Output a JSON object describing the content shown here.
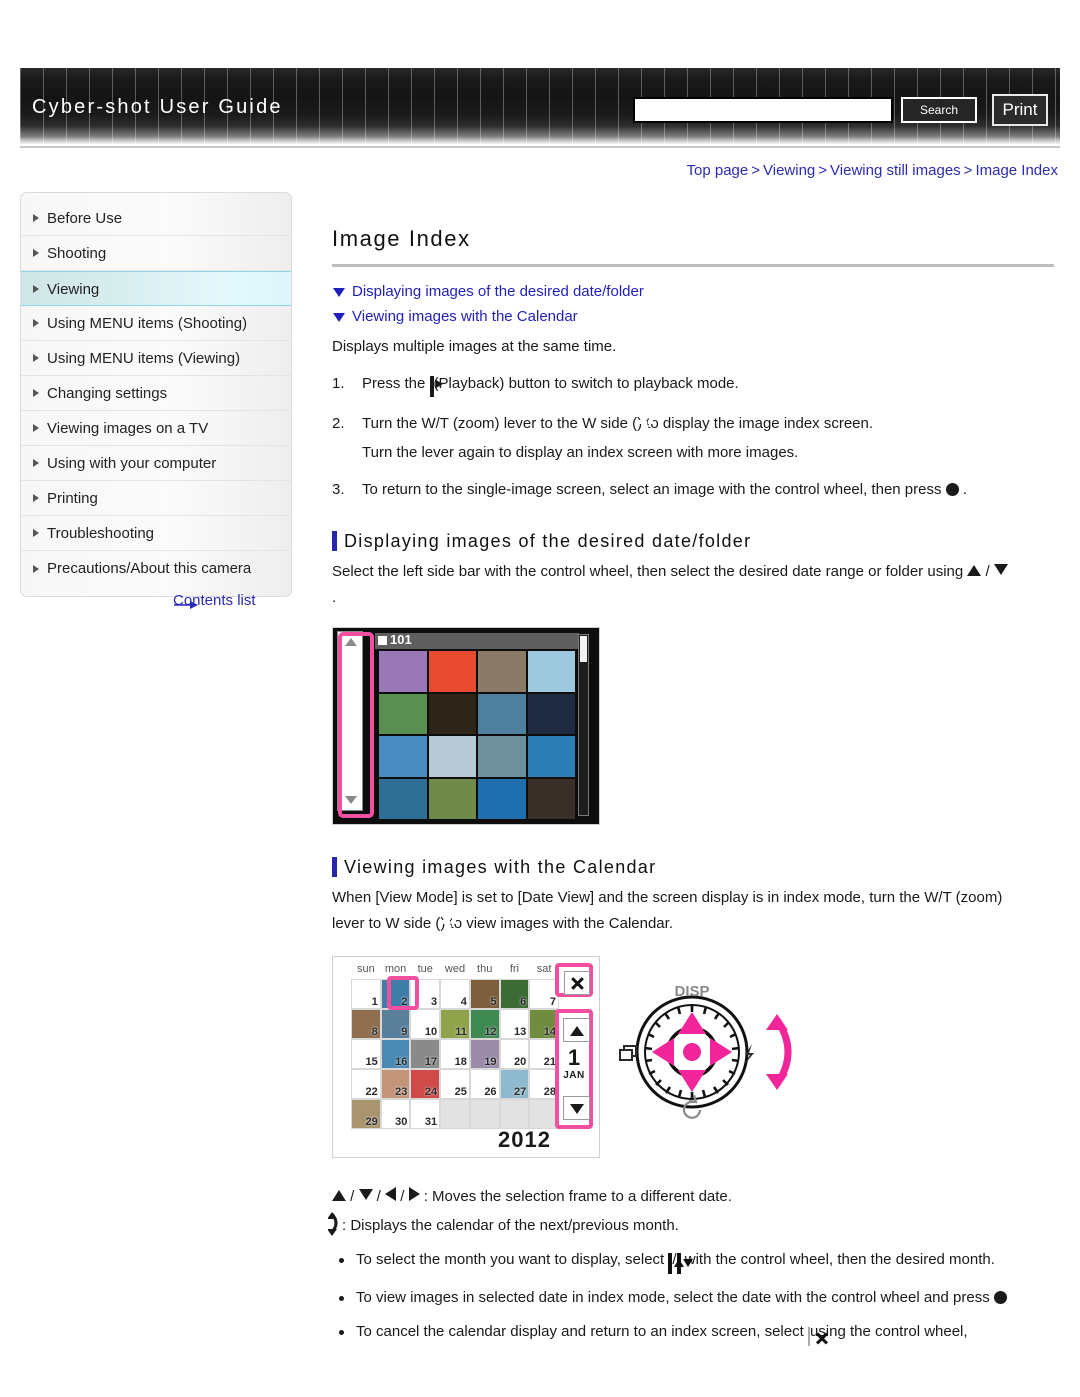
{
  "header": {
    "site_title": "Cyber-shot User Guide",
    "search_value": "",
    "search_placeholder": "",
    "search_label": "Search",
    "print_label": "Print"
  },
  "breadcrumb": {
    "items": [
      "Top page",
      "Viewing",
      "Viewing still images",
      "Image Index"
    ],
    "separator": ">"
  },
  "sidebar": {
    "items": [
      {
        "label": "Before Use",
        "active": false
      },
      {
        "label": "Shooting",
        "active": false
      },
      {
        "label": "Viewing",
        "active": true
      },
      {
        "label": "Using MENU items (Shooting)",
        "active": false
      },
      {
        "label": "Using MENU items (Viewing)",
        "active": false
      },
      {
        "label": "Changing settings",
        "active": false
      },
      {
        "label": "Viewing images on a TV",
        "active": false
      },
      {
        "label": "Using with your computer",
        "active": false
      },
      {
        "label": "Printing",
        "active": false
      },
      {
        "label": "Troubleshooting",
        "active": false
      },
      {
        "label": "Precautions/About this camera",
        "active": false
      }
    ],
    "contents_link": "Contents list"
  },
  "main": {
    "title": "Image Index",
    "jump_links": [
      "Displaying images of the desired date/folder",
      "Viewing images with the Calendar"
    ],
    "intro": "Displays multiple images at the same time.",
    "steps": [
      {
        "num": "1.",
        "pre": "Press the",
        "icon": "playback-icon",
        "post": "(Playback) button to switch to playback mode."
      },
      {
        "num": "2.",
        "pre": "Turn the W/T (zoom) lever to the W side (",
        "icon": "index-zoom-icon",
        "post": ") to display the image index screen.",
        "line2": "Turn the lever again to display an index screen with more images."
      },
      {
        "num": "3.",
        "pre": "To return to the single-image screen, select an image with the control wheel, then press",
        "icon": "center-button-icon",
        "post": "."
      }
    ],
    "section1": {
      "heading": "Displaying images of the desired date/folder",
      "paragraph_pre": "Select the left side bar with the control wheel, then select the desired date range or folder using",
      "paragraph_icons": "▲ / ▼",
      "paragraph_post": "."
    },
    "section2": {
      "heading": "Viewing images with the Calendar",
      "paragraph_pre": "When [View Mode] is set to [Date View] and the screen display is in index mode, turn the W/T (zoom)",
      "paragraph_line2_pre": "lever to W side (",
      "paragraph_line2_post": ") to view images with the Calendar.",
      "keys_line": ": Moves the selection frame to a different date.",
      "keys_prefix": "▲ / ▼ / ◀ / ▶",
      "rotate_line": ": Displays the calendar of the next/previous month.",
      "bullets": [
        {
          "pre": "To select the month you want to display, select",
          "icons": "▲/▼",
          "post": "with the control wheel, then the desired month."
        },
        {
          "pre": "To view images in selected date in index mode, select the date with the control wheel and press",
          "icons": "●",
          "post": ""
        },
        {
          "pre": "To cancel the calendar display and return to an index screen, select",
          "icons": "✕",
          "post": "using the control wheel,"
        }
      ]
    }
  },
  "index_figure": {
    "folder_label": "101",
    "sidebar_up_icon": "scroll-up-icon",
    "sidebar_down_icon": "scroll-down-icon",
    "thumbnail_colors": [
      "#9a78b8",
      "#e84a30",
      "#8a7a68",
      "#9dc8dd",
      "#5b8f52",
      "#2e2418",
      "#4e7f9d",
      "#1d2a42",
      "#4b8cc0",
      "#b7c9d4",
      "#6e8f9c",
      "#2b7fb5",
      "#2f6f96",
      "#6f8a4a",
      "#1f6fae",
      "#3a2f28"
    ]
  },
  "calendar_figure": {
    "day_names": [
      "sun",
      "mon",
      "tue",
      "wed",
      "thu",
      "fri",
      "sat"
    ],
    "leading_blanks": 0,
    "days": [
      1,
      2,
      3,
      4,
      5,
      6,
      7,
      8,
      9,
      10,
      11,
      12,
      13,
      14,
      15,
      16,
      17,
      18,
      19,
      20,
      21,
      22,
      23,
      24,
      25,
      26,
      27,
      28,
      29,
      30,
      31
    ],
    "selected_day": 1,
    "month_number": "1",
    "month_name": "JAN",
    "year": "2012",
    "close_icon": "close-icon",
    "month_up_icon": "month-up-icon",
    "month_down_icon": "month-down-icon",
    "day_thumb_colors": {
      "2": "#3e7ea8",
      "5": "#7d5e3c",
      "6": "#3c6b35",
      "8": "#8f6f50",
      "9": "#5a7f9b",
      "11": "#8fa34a",
      "12": "#3e8a52",
      "14": "#6f8c3f",
      "16": "#4a8ab5",
      "17": "#8a8a8a",
      "19": "#9a8ca8",
      "23": "#c2957a",
      "24": "#cf4a48",
      "27": "#8fb9cf",
      "29": "#a8956f"
    }
  },
  "wheel_figure": {
    "label_top": "DISP",
    "label_left_icon": "image-burst-icon",
    "label_right_icon": "flash-icon",
    "label_bottom_icon": "self-timer-icon",
    "accent_color": "#f2269a"
  },
  "colors": {
    "link": "#2b2bb5",
    "jump_link": "#1f1fbb",
    "section_bar": "#2626a8",
    "active_nav": "#ddf6fb",
    "highlight_pink": "#f24fa0",
    "header_dark": "#141414"
  }
}
